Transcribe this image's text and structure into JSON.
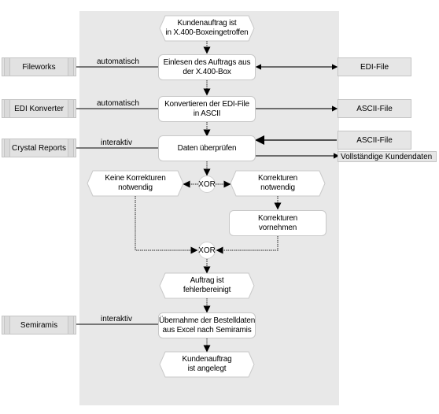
{
  "events": {
    "start": "Kundenauftrag ist\nin X.400-Boxeingetroffen",
    "keine_korrekturen": "Keine Korrekturen\nnotwendig",
    "korrekturen_notwendig": "Korrekturen\nnotwendig",
    "fehlerbereinigt": "Auftrag ist\nfehlerbereinigt",
    "end": "Kundenauftrag\nist angelegt"
  },
  "functions": {
    "einlesen": "Einlesen des Auftrags aus\nder X.400-Box",
    "konvertieren": "Konvertieren der EDI-File\nin ASCII",
    "pruefen": "Daten überprüfen",
    "korrekturen_vornehmen": "Korrekturen\nvornehmen",
    "uebernahme": "Übernahme der Bestelldaten\naus Excel nach Semiramis"
  },
  "operators": {
    "split": "XOR",
    "join": "XOR"
  },
  "systems": {
    "fileworks": "Fileworks",
    "edi_konverter": "EDI Konverter",
    "crystal_reports": "Crystal Reports",
    "semiramis": "Semiramis"
  },
  "connection_labels": {
    "fileworks": "automatisch",
    "edi_konverter": "automatisch",
    "crystal_reports": "interaktiv",
    "semiramis": "interaktiv"
  },
  "files": {
    "edi_file": "EDI-File",
    "ascii_out": "ASCII-File",
    "ascii_in": "ASCII-File",
    "kundendaten": "Vollständige Kundendaten"
  }
}
